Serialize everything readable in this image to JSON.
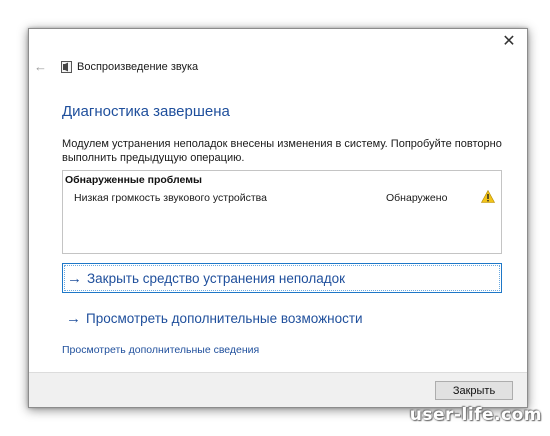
{
  "window": {
    "title": "Воспроизведение звука",
    "close_glyph": "✕",
    "back_glyph": "←"
  },
  "main": {
    "heading": "Диагностика завершена",
    "message": "Модулем устранения неполадок внесены изменения в систему. Попробуйте повторно выполнить предыдущую операцию.",
    "problems": {
      "header": "Обнаруженные проблемы",
      "items": [
        {
          "name": "Низкая громкость звукового устройства",
          "status": "Обнаружено",
          "icon": "warning-icon"
        }
      ]
    },
    "links": {
      "close_troubleshooter": "Закрыть средство устранения неполадок",
      "more_options": "Просмотреть дополнительные возможности",
      "more_details": "Просмотреть дополнительные сведения"
    },
    "arrow_glyph": "→"
  },
  "footer": {
    "close_button": "Закрыть"
  },
  "watermark": "user-life.com",
  "colors": {
    "accent": "#1f4f9c",
    "focus_border": "#1e78c8",
    "warning": "#f2c318",
    "footer_bg": "#f0f0f0"
  }
}
